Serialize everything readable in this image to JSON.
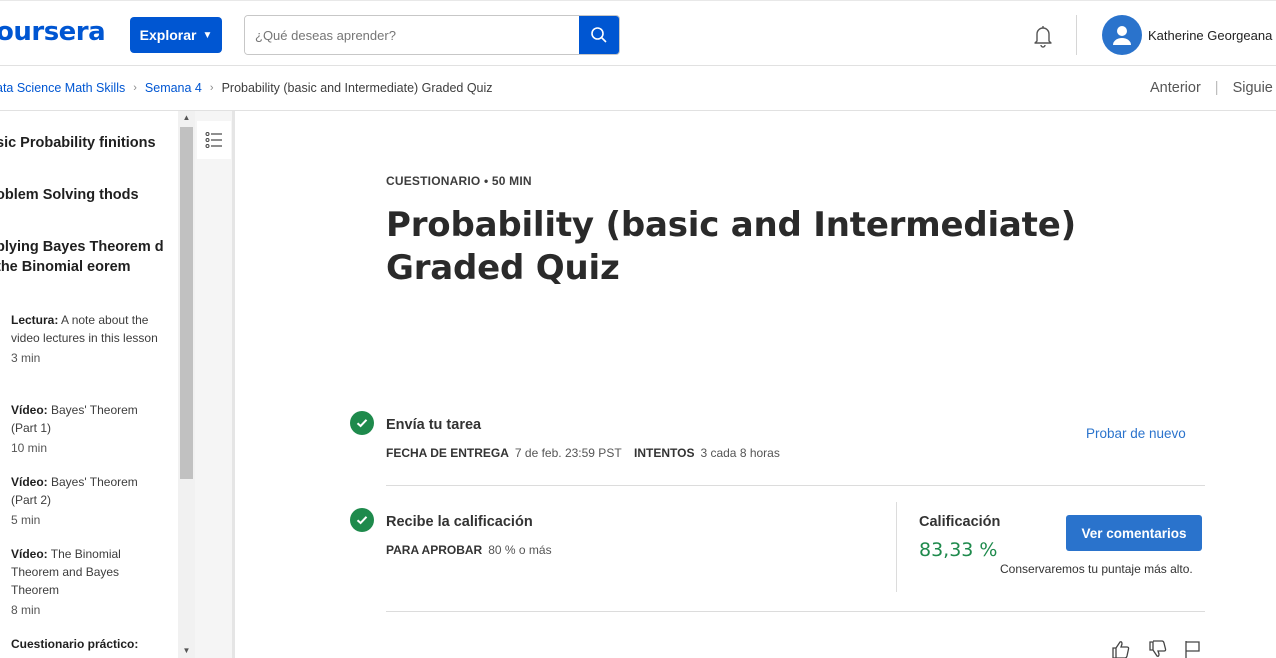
{
  "header": {
    "logo": "oursera",
    "explore_label": "Explorar",
    "search_placeholder": "¿Qué deseas aprender?",
    "user_name": "Katherine Georgeana ."
  },
  "breadcrumb": {
    "items": [
      "ata Science Math Skills",
      "Semana 4",
      "Probability (basic and Intermediate) Graded Quiz"
    ],
    "prev_label": "Anterior",
    "next_label": "Siguie"
  },
  "sidebar": {
    "sections": [
      "sic Probability finitions",
      "oblem Solving thods",
      "plying Bayes Theorem d the Binomial eorem"
    ],
    "items": [
      {
        "type": "Lectura:",
        "title": " A note about the video lectures in this lesson",
        "duration": "3 min"
      },
      {
        "type": "Vídeo:",
        "title": " Bayes' Theorem (Part 1)",
        "duration": "10 min"
      },
      {
        "type": "Vídeo:",
        "title": " Bayes' Theorem (Part 2)",
        "duration": "5 min"
      },
      {
        "type": "Vídeo:",
        "title": " The Binomial Theorem and Bayes Theorem",
        "duration": "8 min"
      },
      {
        "type": "Cuestionario práctico:",
        "title": "",
        "duration": ""
      }
    ]
  },
  "main": {
    "kicker": "CUESTIONARIO • 50 MIN",
    "title": "Probability (basic and Intermediate) Graded Quiz",
    "submit": {
      "title": "Envía tu tarea",
      "due_label": "FECHA DE ENTREGA",
      "due_value": "7 de feb. 23:59 PST",
      "attempts_label": "INTENTOS",
      "attempts_value": "3 cada 8 horas",
      "retry_label": "Probar de nuevo"
    },
    "grade": {
      "title": "Recibe la calificación",
      "pass_label": "PARA APROBAR",
      "pass_value": "80 % o más",
      "grade_label": "Calificación",
      "grade_value": "83,33 %",
      "view_label": "Ver comentarios",
      "keep_note": "Conservaremos tu puntaje más alto."
    }
  },
  "colors": {
    "brand": "#0056d2",
    "success": "#1e8a4c",
    "link": "#2a73cc"
  }
}
